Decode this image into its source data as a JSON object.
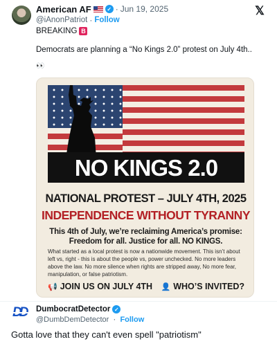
{
  "tweet": {
    "author_name": "American AF",
    "author_handle": "@iAnonPatriot",
    "date": "Jun 19, 2025",
    "separator": "·",
    "follow_label": "Follow",
    "breaking_label": "BREAKING",
    "breaking_badge": "B",
    "text": "Democrats are planning a “No Kings 2.0” protest on July 4th..",
    "emoji_line": "👀",
    "icons": {
      "flag": "us-flag-icon",
      "verified": "verified-badge-icon",
      "logo": "x-logo-icon"
    }
  },
  "poster": {
    "title": "NO KINGS 2.0",
    "subtitle": "NATIONAL PROTEST – JULY 4TH, 2025",
    "headline": "INDEPENDENCE WITHOUT TYRANNY",
    "reclaim_line1": "This 4th of July, we’re reclaiming America’s promise:",
    "reclaim_line2": "Freedom for all. Justice for all. NO KINGS.",
    "body": "What started as a local protest is now a nationwide movement. This isn’t about left vs, right - this is about the people vs, power unchecked. No more leaders above the law. No more silence when rights are stripped away, No more fear, manipulation, or false patriotism.",
    "join_label": "JOIN US ON JULY 4TH",
    "invited_label": "WHO’S INVITED?",
    "colors": {
      "red": "#c33a3d",
      "navy": "#2b4470",
      "headline_red": "#b32025",
      "background": "#f2ece0"
    }
  },
  "reply": {
    "author_name": "DumbocratDetector",
    "author_handle": "@DumbDemDetector",
    "separator": "·",
    "follow_label": "Follow",
    "logo_text": "DD",
    "text": "Gotta love that they can't even spell \"patriotism\""
  },
  "theme": {
    "link_color": "#1d9bf0",
    "muted_text": "#536471"
  }
}
